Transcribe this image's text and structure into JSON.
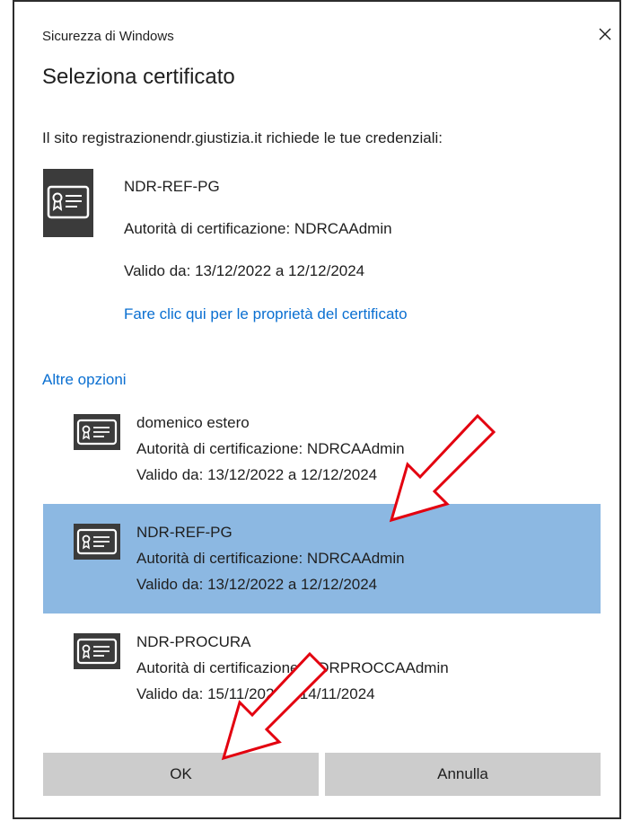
{
  "window": {
    "title": "Sicurezza di Windows"
  },
  "heading": "Seleziona certificato",
  "prompt": "Il sito registrazionendr.giustizia.it richiede le tue credenziali:",
  "primary_cert": {
    "name": "NDR-REF-PG",
    "issuer": "Autorità di certificazione: NDRCAAdmin",
    "validity": "Valido da: 13/12/2022 a 12/12/2024",
    "properties_link": "Fare clic qui per le proprietà del certificato"
  },
  "more_options_label": "Altre opzioni",
  "cert_list": [
    {
      "name": "domenico estero",
      "issuer": "Autorità di certificazione: NDRCAAdmin",
      "validity": "Valido da: 13/12/2022 a 12/12/2024",
      "selected": false
    },
    {
      "name": "NDR-REF-PG",
      "issuer": "Autorità di certificazione: NDRCAAdmin",
      "validity": "Valido da: 13/12/2022 a 12/12/2024",
      "selected": true
    },
    {
      "name": "NDR-PROCURA",
      "issuer": "Autorità di certificazione: NDRPROCCAAdmin",
      "validity": "Valido da: 15/11/2022 a 14/11/2024",
      "selected": false
    }
  ],
  "buttons": {
    "ok_label": "OK",
    "cancel_label": "Annulla"
  },
  "colors": {
    "link": "#0a6fd1",
    "selected_row": "#8cb8e2",
    "button_bg": "#cccccc",
    "annotation_arrow": "#e3000f",
    "icon_dark": "#3b3b3b"
  },
  "icons": {
    "close": "close-icon",
    "certificate": "certificate-icon"
  }
}
